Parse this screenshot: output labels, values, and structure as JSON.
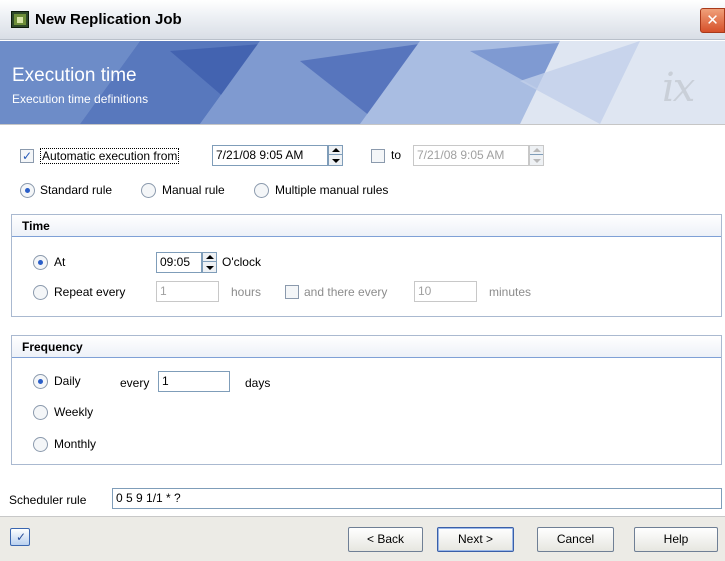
{
  "window": {
    "title": "New Replication Job",
    "close_glyph": "✕"
  },
  "banner": {
    "title": "Execution time",
    "subtitle": "Execution time definitions",
    "logo": "ix"
  },
  "execution": {
    "auto_label": "Automatic execution from",
    "auto_checked": true,
    "from_value": "7/21/08 9:05 AM",
    "to_label": "to",
    "to_checked": false,
    "to_value": "7/21/08 9:05 AM"
  },
  "rules": {
    "options": [
      "Standard rule",
      "Manual rule",
      "Multiple manual rules"
    ],
    "selected": "Standard rule"
  },
  "time": {
    "title": "Time",
    "at_label": "At",
    "at_value": "09:05",
    "oclock_label": "O'clock",
    "repeat_label": "Repeat every",
    "repeat_value": "1",
    "hours_label": "hours",
    "and_there_label": "and there every",
    "minutes_value": "10",
    "minutes_label": "minutes",
    "selected": "At"
  },
  "frequency": {
    "title": "Frequency",
    "options": [
      "Daily",
      "Weekly",
      "Monthly"
    ],
    "selected": "Daily",
    "every_label": "every",
    "every_value": "1",
    "days_label": "days"
  },
  "scheduler": {
    "label": "Scheduler rule",
    "value": "0 5 9 1/1 * ?"
  },
  "buttons": {
    "back": "< Back",
    "next": "Next >",
    "cancel": "Cancel",
    "help": "Help"
  },
  "icons": {
    "app": "app-icon",
    "close": "close-icon",
    "help": "help-check-icon"
  },
  "colors": {
    "accent": "#2a5ec8",
    "banner": "#8fa6d4",
    "close": "#d6502a"
  }
}
